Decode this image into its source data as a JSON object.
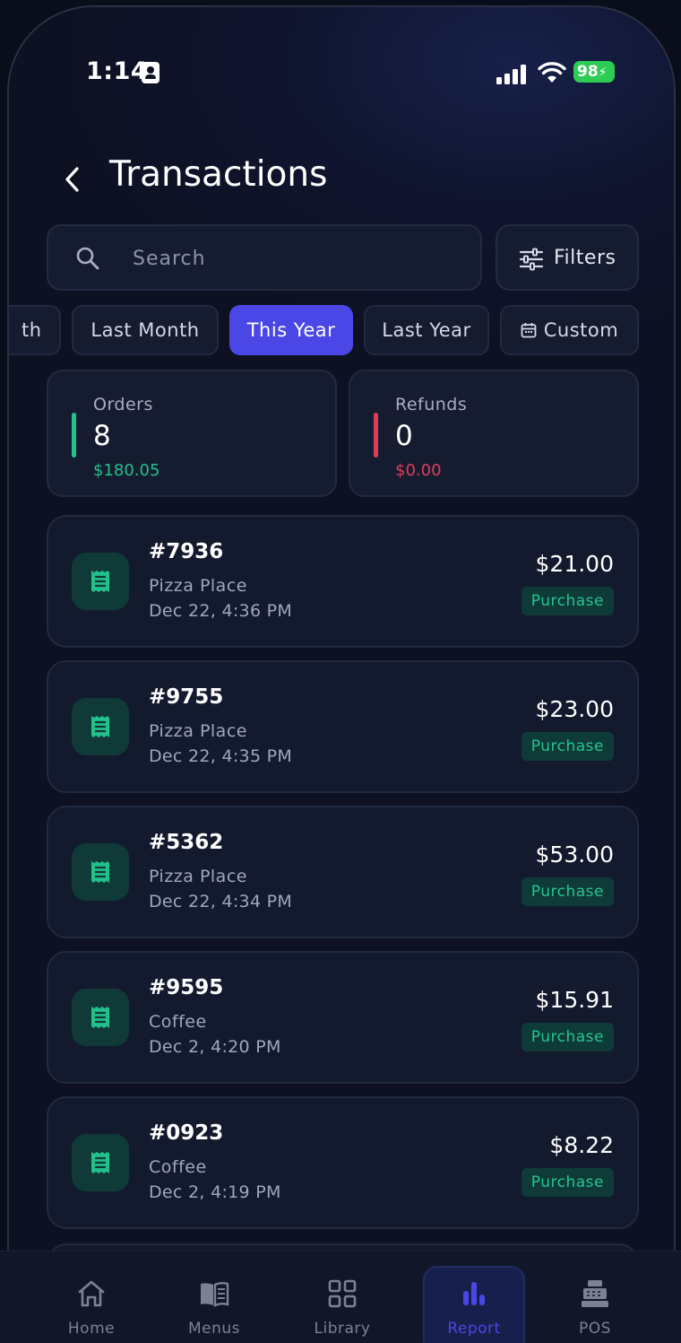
{
  "status_bar": {
    "time": "1:14",
    "battery": "98"
  },
  "header": {
    "title": "Transactions"
  },
  "search": {
    "placeholder": "Search"
  },
  "filters": {
    "label": "Filters"
  },
  "period_chips": [
    {
      "label": "th"
    },
    {
      "label": "Last Month"
    },
    {
      "label": "This Year",
      "active": true
    },
    {
      "label": "Last Year"
    },
    {
      "label": "Custom"
    }
  ],
  "stats": {
    "orders": {
      "label": "Orders",
      "value": "8",
      "amount": "$180.05",
      "color": "#22c08a"
    },
    "refunds": {
      "label": "Refunds",
      "value": "0",
      "amount": "$0.00",
      "color": "#e23b57"
    }
  },
  "transactions": [
    {
      "id": "#7936",
      "merchant": "Pizza Place",
      "date": "Dec 22, 4:36 PM",
      "amount": "$21.00",
      "type": "Purchase"
    },
    {
      "id": "#9755",
      "merchant": "Pizza Place",
      "date": "Dec 22, 4:35 PM",
      "amount": "$23.00",
      "type": "Purchase"
    },
    {
      "id": "#5362",
      "merchant": "Pizza Place",
      "date": "Dec 22, 4:34 PM",
      "amount": "$53.00",
      "type": "Purchase"
    },
    {
      "id": "#9595",
      "merchant": "Coffee",
      "date": "Dec 2, 4:20 PM",
      "amount": "$15.91",
      "type": "Purchase"
    },
    {
      "id": "#0923",
      "merchant": "Coffee",
      "date": "Dec 2, 4:19 PM",
      "amount": "$8.22",
      "type": "Purchase"
    }
  ],
  "tab_bar": {
    "tabs": [
      {
        "label": "Home",
        "icon": "home-icon"
      },
      {
        "label": "Menus",
        "icon": "book-icon"
      },
      {
        "label": "Library",
        "icon": "grid-icon"
      },
      {
        "label": "Report",
        "icon": "bar-chart-icon",
        "active": true
      },
      {
        "label": "POS",
        "icon": "cash-register-icon"
      }
    ]
  },
  "colors": {
    "accent": "#4a47e6",
    "success": "#22c08a",
    "danger": "#e23b57"
  }
}
